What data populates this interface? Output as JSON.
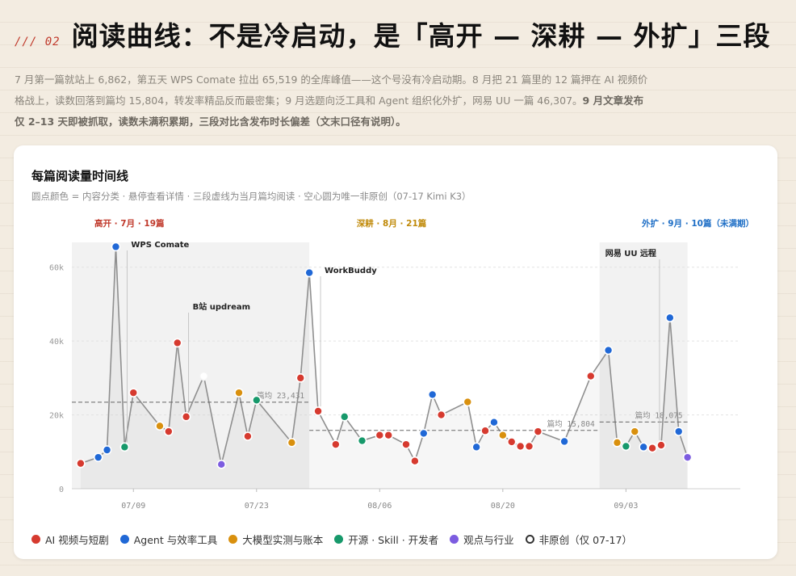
{
  "header": {
    "section_label": "/// 02",
    "title": "阅读曲线：不是冷启动，是「高开 — 深耕 — 外扩」三段",
    "intro_normal": "7 月第一篇就站上 6,862，第五天 WPS Comate 拉出 65,519 的全库峰值——这个号没有冷启动期。8 月把 21 篇里的 12 篇押在 AI 视频价格战上，读数回落到篇均 15,804，转发率精品反而最密集；9 月选题向泛工具和 Agent 组织化外扩，网易 UU 一篇 46,307。",
    "intro_strong": "9 月文章发布仅 2–13 天即被抓取，读数未满积累期，三段对比含发布时长偏差（文末口径有说明）。"
  },
  "card": {
    "title": "每篇阅读量时间线",
    "subtitle": "圆点颜色 = 内容分类 · 悬停查看详情 · 三段虚线为当月篇均阅读 · 空心圆为唯一非原创（07-17 Kimi K3）"
  },
  "colors": {
    "ai_video": "#d63a2f",
    "agent": "#2068d6",
    "llm": "#d9900e",
    "opensource": "#17996b",
    "opinion": "#7c5ce0",
    "red": "#c0392b",
    "gold": "#c08a0a",
    "blue": "#1f6fc6"
  },
  "legend": [
    {
      "label": "AI 视频与短剧",
      "cat": "ai_video"
    },
    {
      "label": "Agent 与效率工具",
      "cat": "agent"
    },
    {
      "label": "大模型实测与账本",
      "cat": "llm"
    },
    {
      "label": "开源 · Skill · 开发者",
      "cat": "opensource"
    },
    {
      "label": "观点与行业",
      "cat": "opinion"
    },
    {
      "label": "非原创（仅 07-17）",
      "cat": "nonoriginal"
    }
  ],
  "chart_data": {
    "type": "scatter",
    "title": "每篇阅读量时间线",
    "x_axis": {
      "type": "date",
      "range": [
        "2025-07-02",
        "2025-09-16"
      ],
      "ticks": [
        "07/09",
        "07/23",
        "08/06",
        "08/20",
        "09/03"
      ]
    },
    "y_axis": {
      "range": [
        0,
        70000
      ],
      "ticks": [
        0,
        20000,
        40000,
        60000
      ],
      "tick_labels": [
        "0",
        "20k",
        "40k",
        "60k"
      ]
    },
    "phases": [
      {
        "label": "高开 · 7月 · 19篇",
        "range": [
          "2025-07-02",
          "2025-07-29"
        ],
        "mean": 23431,
        "mean_label": "篇均 23,431",
        "color": "red",
        "shaded": true
      },
      {
        "label": "深耕 · 8月 · 21篇",
        "range": [
          "2025-07-29",
          "2025-08-31"
        ],
        "mean": 15804,
        "mean_label": "篇均 15,804",
        "color": "gold",
        "shaded": false
      },
      {
        "label": "外扩 · 9月 · 10篇（未满期）",
        "range": [
          "2025-08-31",
          "2025-09-10"
        ],
        "mean": 18075,
        "mean_label": "篇均 18,075",
        "color": "blue",
        "shaded": true
      }
    ],
    "annotations": [
      {
        "text": "WPS Comate",
        "index": 4
      },
      {
        "text": "B站 updream",
        "index": 9
      },
      {
        "text": "WorkBuddy",
        "index": 18
      },
      {
        "text": "网易 UU 远程",
        "index": 46
      }
    ],
    "points": [
      {
        "date": "2025-07-03",
        "value": 6862,
        "cat": "ai_video"
      },
      {
        "date": "2025-07-05",
        "value": 8500,
        "cat": "agent"
      },
      {
        "date": "2025-07-06",
        "value": 10500,
        "cat": "agent"
      },
      {
        "date": "2025-07-07",
        "value": 65519,
        "cat": "agent"
      },
      {
        "date": "2025-07-08",
        "value": 11300,
        "cat": "opensource"
      },
      {
        "date": "2025-07-09",
        "value": 26000,
        "cat": "ai_video"
      },
      {
        "date": "2025-07-12",
        "value": 17000,
        "cat": "llm"
      },
      {
        "date": "2025-07-13",
        "value": 15500,
        "cat": "ai_video"
      },
      {
        "date": "2025-07-14",
        "value": 39500,
        "cat": "ai_video"
      },
      {
        "date": "2025-07-15",
        "value": 19500,
        "cat": "ai_video"
      },
      {
        "date": "2025-07-17",
        "value": 30500,
        "cat": "nonoriginal"
      },
      {
        "date": "2025-07-19",
        "value": 6600,
        "cat": "opinion"
      },
      {
        "date": "2025-07-21",
        "value": 26000,
        "cat": "llm"
      },
      {
        "date": "2025-07-22",
        "value": 14200,
        "cat": "ai_video"
      },
      {
        "date": "2025-07-23",
        "value": 24000,
        "cat": "opensource"
      },
      {
        "date": "2025-07-27",
        "value": 12500,
        "cat": "llm"
      },
      {
        "date": "2025-07-28",
        "value": 30000,
        "cat": "ai_video"
      },
      {
        "date": "2025-07-29",
        "value": 58500,
        "cat": "agent"
      },
      {
        "date": "2025-07-30",
        "value": 21000,
        "cat": "ai_video"
      },
      {
        "date": "2025-08-01",
        "value": 12000,
        "cat": "ai_video"
      },
      {
        "date": "2025-08-02",
        "value": 19500,
        "cat": "opensource"
      },
      {
        "date": "2025-08-04",
        "value": 13000,
        "cat": "opensource"
      },
      {
        "date": "2025-08-06",
        "value": 14500,
        "cat": "ai_video"
      },
      {
        "date": "2025-08-07",
        "value": 14500,
        "cat": "ai_video"
      },
      {
        "date": "2025-08-09",
        "value": 12000,
        "cat": "ai_video"
      },
      {
        "date": "2025-08-10",
        "value": 7500,
        "cat": "ai_video"
      },
      {
        "date": "2025-08-11",
        "value": 15000,
        "cat": "agent"
      },
      {
        "date": "2025-08-12",
        "value": 25500,
        "cat": "agent"
      },
      {
        "date": "2025-08-13",
        "value": 20000,
        "cat": "ai_video"
      },
      {
        "date": "2025-08-16",
        "value": 23500,
        "cat": "llm"
      },
      {
        "date": "2025-08-17",
        "value": 11300,
        "cat": "agent"
      },
      {
        "date": "2025-08-18",
        "value": 15700,
        "cat": "ai_video"
      },
      {
        "date": "2025-08-19",
        "value": 18000,
        "cat": "agent"
      },
      {
        "date": "2025-08-20",
        "value": 14500,
        "cat": "llm"
      },
      {
        "date": "2025-08-21",
        "value": 12700,
        "cat": "ai_video"
      },
      {
        "date": "2025-08-22",
        "value": 11500,
        "cat": "ai_video"
      },
      {
        "date": "2025-08-23",
        "value": 11500,
        "cat": "ai_video"
      },
      {
        "date": "2025-08-24",
        "value": 15500,
        "cat": "ai_video"
      },
      {
        "date": "2025-08-27",
        "value": 12800,
        "cat": "agent"
      },
      {
        "date": "2025-08-30",
        "value": 30500,
        "cat": "ai_video"
      },
      {
        "date": "2025-09-01",
        "value": 37500,
        "cat": "agent"
      },
      {
        "date": "2025-09-02",
        "value": 12500,
        "cat": "llm"
      },
      {
        "date": "2025-09-03",
        "value": 11500,
        "cat": "opensource"
      },
      {
        "date": "2025-09-04",
        "value": 15500,
        "cat": "llm"
      },
      {
        "date": "2025-09-05",
        "value": 11300,
        "cat": "agent"
      },
      {
        "date": "2025-09-06",
        "value": 11000,
        "cat": "ai_video"
      },
      {
        "date": "2025-09-07",
        "value": 11800,
        "cat": "ai_video"
      },
      {
        "date": "2025-09-08",
        "value": 46307,
        "cat": "agent"
      },
      {
        "date": "2025-09-09",
        "value": 15500,
        "cat": "agent"
      },
      {
        "date": "2025-09-10",
        "value": 8500,
        "cat": "opinion"
      }
    ]
  }
}
